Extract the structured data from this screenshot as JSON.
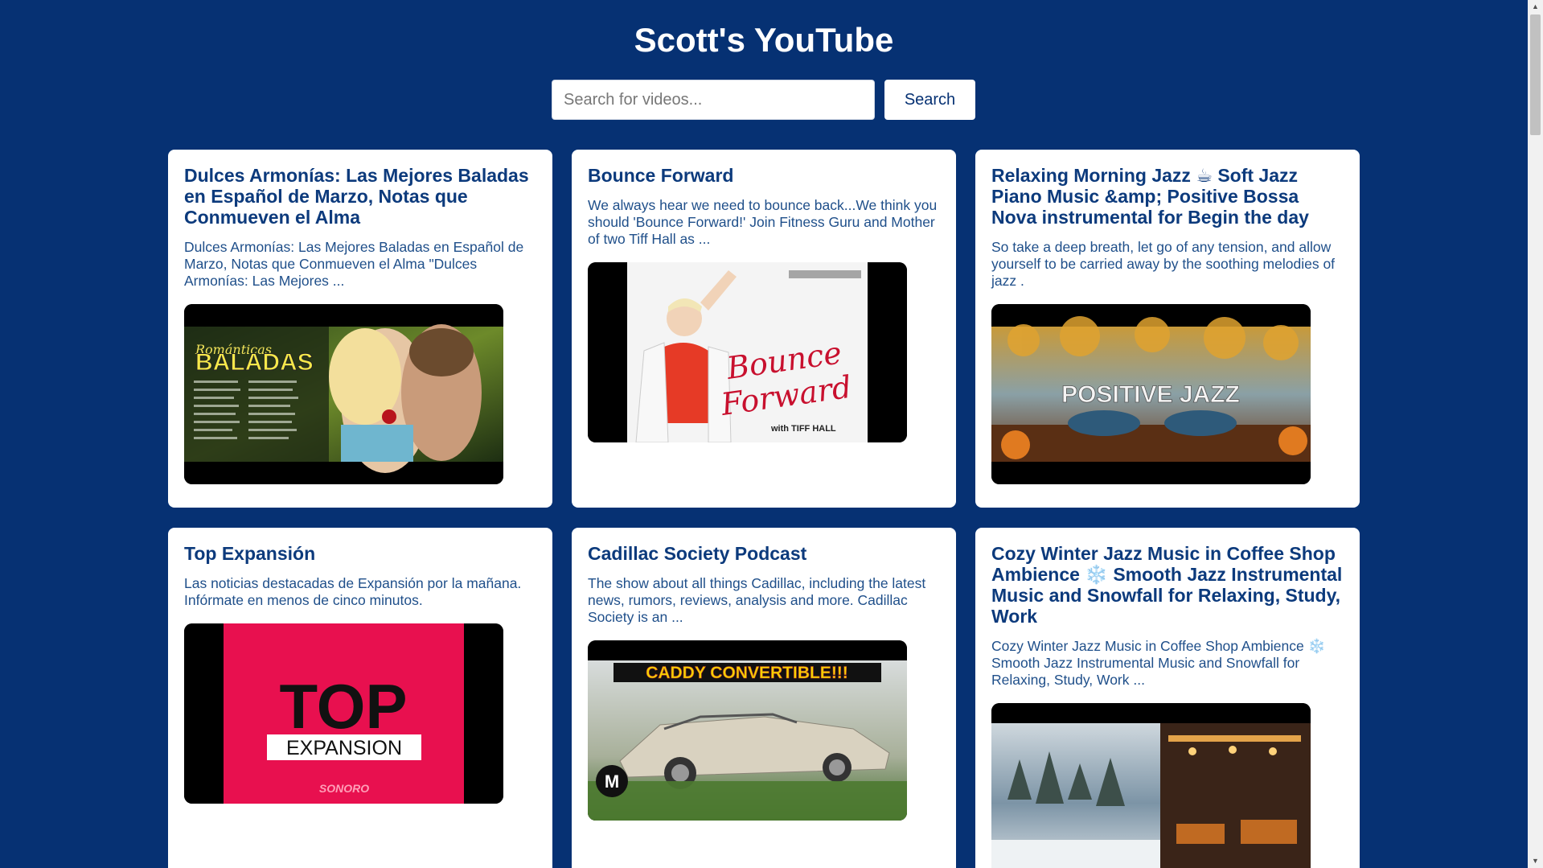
{
  "header": {
    "title": "Scott's YouTube"
  },
  "search": {
    "placeholder": "Search for videos...",
    "button_label": "Search"
  },
  "videos": [
    {
      "title": "Dulces Armonías: Las Mejores Baladas en Español de Marzo, Notas que Conmueven el Alma",
      "description": "Dulces Armonías: Las Mejores Baladas en Español de Marzo, Notas que Conmueven el Alma \"Dulces Armonías: Las Mejores ...",
      "thumbnail_text": "BALADAS",
      "thumbnail_script": "Románticas"
    },
    {
      "title": "Bounce Forward",
      "description": "We always hear we need to bounce back...We think you should 'Bounce Forward!' Join Fitness Guru and Mother of two Tiff Hall as ...",
      "thumbnail_text": "Bounce Forward",
      "thumbnail_subtext": "with TIFF HALL"
    },
    {
      "title": "Relaxing Morning Jazz ☕ Soft Jazz Piano Music &amp; Positive Bossa Nova instrumental for Begin the day",
      "description": "So take a deep breath, let go of any tension, and allow yourself to be carried away by the soothing melodies of jazz .",
      "thumbnail_text": "POSITIVE JAZZ"
    },
    {
      "title": "Top Expansión",
      "description": "Las noticias destacadas de Expansión por la mañana. Infórmate en menos de cinco minutos.",
      "thumbnail_text": "TOP",
      "thumbnail_subtext": "EXPANSION",
      "thumbnail_brand": "SONORO"
    },
    {
      "title": "Cadillac Society Podcast",
      "description": "The show about all things Cadillac, including the latest news, rumors, reviews, analysis and more. Cadillac Society is an ...",
      "thumbnail_text": "CADDY CONVERTIBLE!!!",
      "thumbnail_logo": "M"
    },
    {
      "title": "Cozy Winter Jazz Music in Coffee Shop Ambience ❄️ Smooth Jazz Instrumental Music and Snowfall for Relaxing, Study, Work",
      "description": "Cozy Winter Jazz Music in Coffee Shop Ambience ❄️ Smooth Jazz Instrumental Music and Snowfall for Relaxing, Study, Work ..."
    }
  ],
  "colors": {
    "background": "#063173",
    "card": "#ffffff",
    "title_text": "#0c3a7c",
    "desc_text": "#1f4f8a"
  }
}
